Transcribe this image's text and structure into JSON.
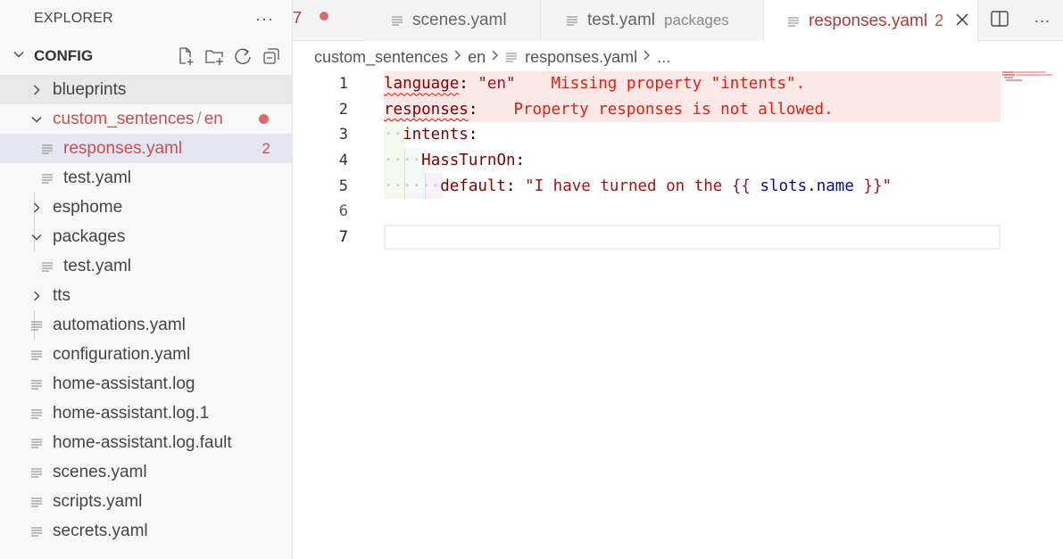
{
  "sidebar": {
    "title": "EXPLORER",
    "more": "···",
    "section": "CONFIG",
    "tree": [
      {
        "label": "blueprints",
        "type": "folder",
        "expanded": false,
        "level": 0
      },
      {
        "label": "custom_sentences",
        "label2": "en",
        "type": "folder",
        "expanded": true,
        "level": 0,
        "modified": true
      },
      {
        "label": "responses.yaml",
        "type": "file",
        "level": 1,
        "selected": true,
        "modified": true,
        "problems": "2"
      },
      {
        "label": "test.yaml",
        "type": "file",
        "level": 1
      },
      {
        "label": "esphome",
        "type": "folder",
        "expanded": false,
        "level": 0
      },
      {
        "label": "packages",
        "type": "folder",
        "expanded": true,
        "level": 0
      },
      {
        "label": "test.yaml",
        "type": "file",
        "level": 1
      },
      {
        "label": "tts",
        "type": "folder",
        "expanded": false,
        "level": 0
      },
      {
        "label": "automations.yaml",
        "type": "file",
        "level": 0
      },
      {
        "label": "configuration.yaml",
        "type": "file",
        "level": 0
      },
      {
        "label": "home-assistant.log",
        "type": "file",
        "level": 0
      },
      {
        "label": "home-assistant.log.1",
        "type": "file",
        "level": 0
      },
      {
        "label": "home-assistant.log.fault",
        "type": "file",
        "level": 0
      },
      {
        "label": "scenes.yaml",
        "type": "file",
        "level": 0
      },
      {
        "label": "scripts.yaml",
        "type": "file",
        "level": 0
      },
      {
        "label": "secrets.yaml",
        "type": "file",
        "level": 0
      }
    ]
  },
  "tabs": [
    {
      "label": "scenes.yaml",
      "description": ""
    },
    {
      "label": "test.yaml",
      "description": "packages"
    },
    {
      "label": "responses.yaml",
      "problems": "2",
      "active": true
    }
  ],
  "tab_overflow_glyph": "7",
  "more_actions": "···",
  "breadcrumb": [
    "custom_sentences",
    "en",
    "responses.yaml",
    "..."
  ],
  "editor": {
    "line_numbers": [
      "1",
      "2",
      "3",
      "4",
      "5",
      "6",
      "7"
    ],
    "lines": {
      "l1_key": "language",
      "l1_colon": ": ",
      "l1_value": "\"en\"",
      "l1_diag": "Missing property \"intents\".",
      "l2_key": "responses",
      "l2_colon": ":",
      "l2_diag": "Property responses is not allowed.",
      "l3_key": "intents",
      "l3_colon": ":",
      "l4_key": "HassTurnOn",
      "l4_colon": ":",
      "l5_key": "default",
      "l5_colon": ": ",
      "l5_q1": "\"I have turned on the ",
      "l5_open": "{{",
      "l5_slots": "slots",
      "l5_dot": ".",
      "l5_name": "name",
      "l5_close": "}}",
      "l5_q2": "\""
    }
  },
  "colors": {
    "error": "#e51400",
    "error_bg": "#fde8e8",
    "modified": "#c94f4f",
    "key": "#800000",
    "string": "#a31515",
    "variable": "#001080"
  }
}
